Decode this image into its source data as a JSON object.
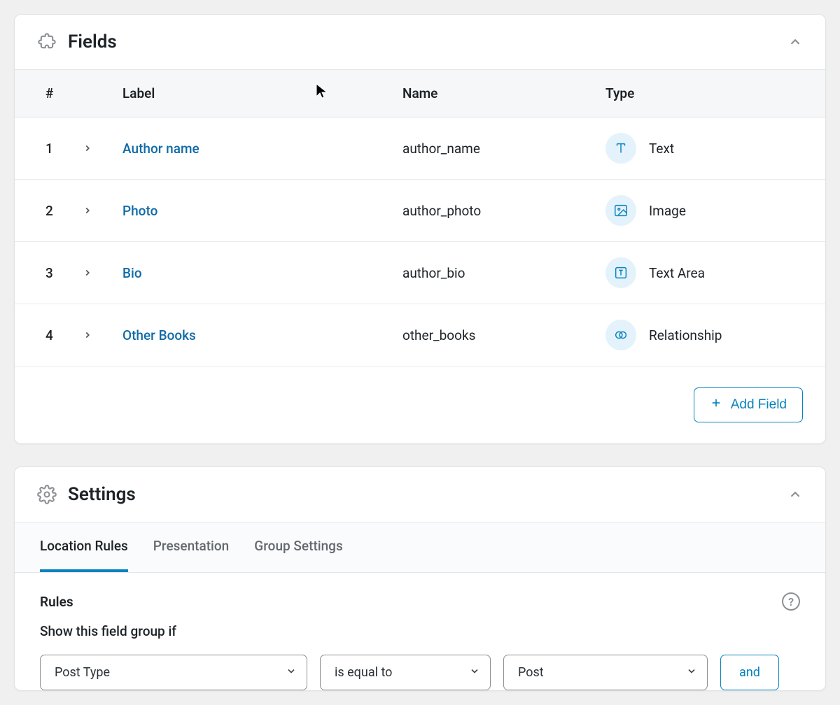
{
  "fields_panel": {
    "title": "Fields",
    "headers": {
      "num": "#",
      "label": "Label",
      "name": "Name",
      "type": "Type"
    },
    "rows": [
      {
        "num": "1",
        "label": "Author name",
        "name": "author_name",
        "type": "Text"
      },
      {
        "num": "2",
        "label": "Photo",
        "name": "author_photo",
        "type": "Image"
      },
      {
        "num": "3",
        "label": "Bio",
        "name": "author_bio",
        "type": "Text Area"
      },
      {
        "num": "4",
        "label": "Other Books",
        "name": "other_books",
        "type": "Relationship"
      }
    ],
    "add_button": "Add Field"
  },
  "settings_panel": {
    "title": "Settings",
    "tabs": [
      {
        "label": "Location Rules",
        "active": true
      },
      {
        "label": "Presentation",
        "active": false
      },
      {
        "label": "Group Settings",
        "active": false
      }
    ],
    "rules": {
      "heading": "Rules",
      "subheading": "Show this field group if",
      "selects": [
        {
          "value": "Post Type"
        },
        {
          "value": "is equal to"
        },
        {
          "value": "Post"
        }
      ],
      "and_label": "and"
    }
  }
}
